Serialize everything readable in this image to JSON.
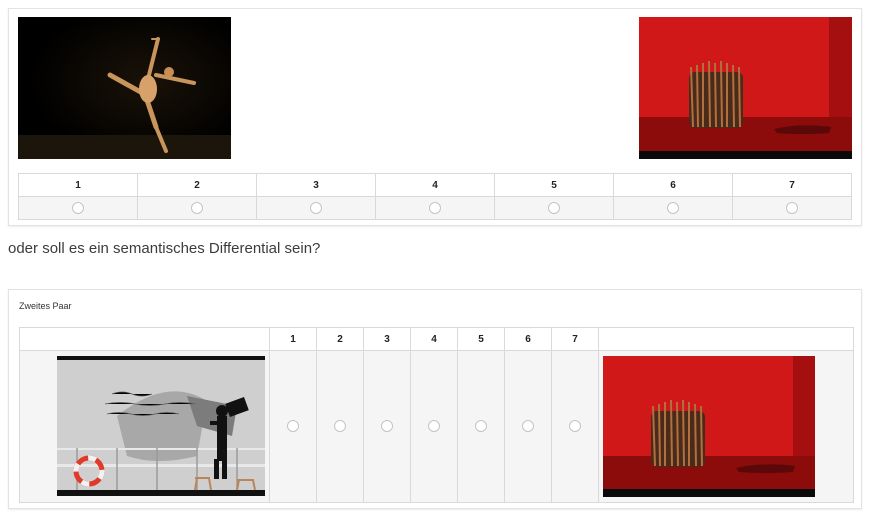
{
  "pair1": {
    "left_image": "dancer-solo-photo",
    "right_image": "dancer-group-red-photo",
    "scale_labels": [
      "1",
      "2",
      "3",
      "4",
      "5",
      "6",
      "7"
    ]
  },
  "question": "oder soll es ein semantisches Differential sein?",
  "pair2": {
    "title": "Zweites Paar",
    "left_image": "theatre-scene-photo",
    "right_image": "dancer-group-red-photo",
    "scale_labels": [
      "1",
      "2",
      "3",
      "4",
      "5",
      "6",
      "7"
    ]
  }
}
